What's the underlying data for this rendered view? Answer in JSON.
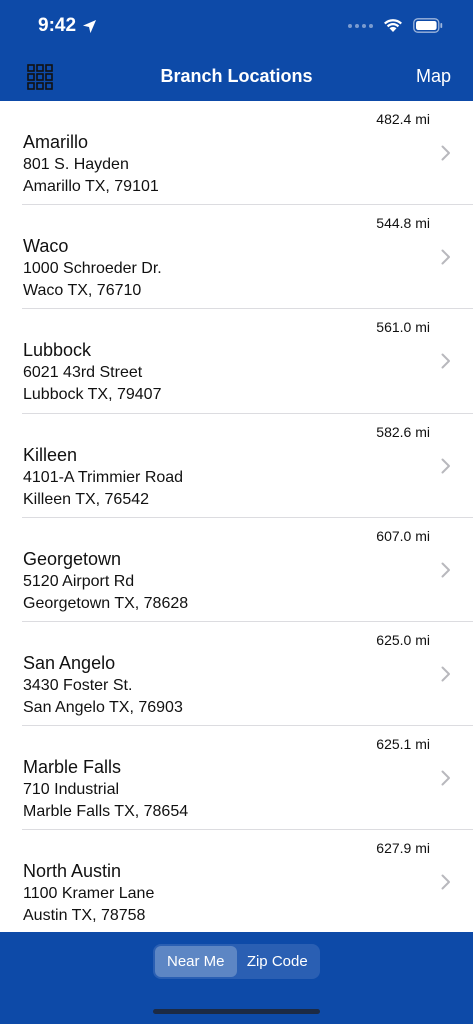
{
  "status": {
    "time": "9:42"
  },
  "nav": {
    "title": "Branch Locations",
    "map_label": "Map"
  },
  "locations": [
    {
      "name": "Amarillo",
      "street": "801 S. Hayden",
      "city": "Amarillo TX, 79101",
      "distance": "482.4 mi"
    },
    {
      "name": "Waco",
      "street": "1000 Schroeder Dr.",
      "city": "Waco TX, 76710",
      "distance": "544.8 mi"
    },
    {
      "name": "Lubbock",
      "street": "6021 43rd Street",
      "city": "Lubbock TX, 79407",
      "distance": "561.0 mi"
    },
    {
      "name": "Killeen",
      "street": "4101-A Trimmier Road",
      "city": "Killeen TX, 76542",
      "distance": "582.6 mi"
    },
    {
      "name": "Georgetown",
      "street": "5120 Airport Rd",
      "city": "Georgetown TX, 78628",
      "distance": "607.0 mi"
    },
    {
      "name": "San Angelo",
      "street": "3430 Foster St.",
      "city": "San Angelo TX, 76903",
      "distance": "625.0 mi"
    },
    {
      "name": "Marble Falls",
      "street": "710 Industrial",
      "city": "Marble Falls TX, 78654",
      "distance": "625.1 mi"
    },
    {
      "name": "North Austin",
      "street": "1100 Kramer Lane",
      "city": "Austin TX, 78758",
      "distance": "627.9 mi"
    }
  ],
  "segments": {
    "near_me": "Near Me",
    "zip_code": "Zip Code",
    "selected": "Near Me"
  },
  "colors": {
    "brand": "#0d4aa8",
    "segment_active": "#5d86c4"
  },
  "icons": {
    "status": [
      "location-arrow-icon",
      "signal-icon",
      "wifi-icon",
      "battery-icon"
    ],
    "nav": [
      "grid-menu-icon"
    ],
    "row": [
      "chevron-right-icon"
    ]
  }
}
